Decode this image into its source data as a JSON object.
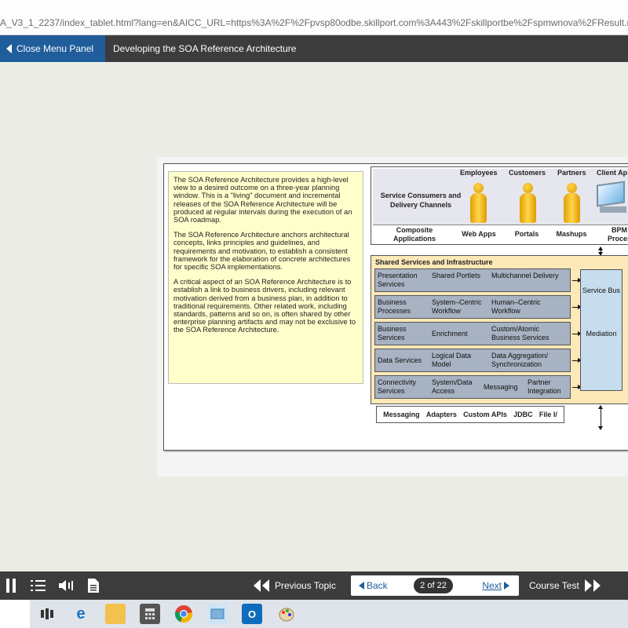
{
  "browser": {
    "url": "A_V3_1_2237/index_tablet.html?lang=en&AICC_URL=https%3A%2F%2Fpvsp80odbe.skillport.com%3A443%2Fskillportbe%2Fspmwnova%2FResult.r"
  },
  "topbar": {
    "close_menu_label": "Close Menu Panel",
    "topic_title": "Developing the SOA Reference Architecture"
  },
  "note": {
    "paragraphs": [
      "The SOA Reference Architecture provides a high-level view to a desired outcome on a three-year planning window. This is a \"living\" document and incremental releases of the SOA Reference Architecture will be produced at regular intervals during the execution of an SOA roadmap.",
      "The SOA Reference Architecture anchors architectural concepts, links principles and guidelines, and requirements and motivation, to establish a consistent framework for the elaboration of concrete architectures for specific SOA implementations.",
      "A critical aspect of an SOA Reference Architecture is to establish a link to business drivers, including relevant motivation derived from a business plan, in addition to traditional requirements. Other related work, including standards, patterns and so on, is often shared by other enterprise planning artifacts and may not be exclusive to the SOA Reference Architecture."
    ]
  },
  "diagram": {
    "consumers_label": "Service Consumers and Delivery Channels",
    "consumer_headers": [
      "Employees",
      "Customers",
      "Partners",
      "Client Ap"
    ],
    "channels": [
      "Composite Applications",
      "Web Apps",
      "Portals",
      "Mashups",
      "BPM Proces"
    ],
    "shared_title": "Shared Services and Infrastructure",
    "rows": [
      [
        "Presentation Services",
        "Shared Portlets",
        "Multichannel Delivery"
      ],
      [
        "Business Processes",
        "System–Centric Workflow",
        "Human–Centric Workflow"
      ],
      [
        "Business Services",
        "Enrichment",
        "Custom/Atomic Business Services"
      ],
      [
        "Data Services",
        "Logical Data Model",
        "Data Aggregation/ Synchronization"
      ],
      [
        "Connectivity Services",
        "System/Data Access",
        "Messaging",
        "Partner Integration"
      ]
    ],
    "bus_label": "Service Bus",
    "mediation_label": "Mediation",
    "bottom_items": [
      "Messaging",
      "Adapters",
      "Custom APIs",
      "JDBC",
      "File I/"
    ]
  },
  "navbar": {
    "previous_label": "Previous Topic",
    "back_label": "Back",
    "page_count": "2 of 22",
    "next_label": "Next",
    "course_test_label": "Course Test"
  }
}
